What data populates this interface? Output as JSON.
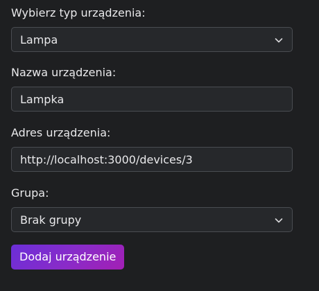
{
  "form": {
    "device_type": {
      "label": "Wybierz typ urządzenia:",
      "selected": "Lampa",
      "icon": "chevron-down-icon"
    },
    "device_name": {
      "label": "Nazwa urządzenia:",
      "value": "Lampka"
    },
    "device_address": {
      "label": "Adres urządzenia:",
      "value": "http://localhost:3000/devices/3"
    },
    "group": {
      "label": "Grupa:",
      "selected": "Brak grupy",
      "icon": "chevron-down-icon"
    },
    "submit_label": "Dodaj urządzenie"
  },
  "colors": {
    "background": "#1e1f21",
    "field_background": "#26282b",
    "field_border": "#4a4d52",
    "text": "#e9e9eb",
    "button_gradient_start": "#6b2fd8",
    "button_gradient_end": "#a31fb4"
  }
}
